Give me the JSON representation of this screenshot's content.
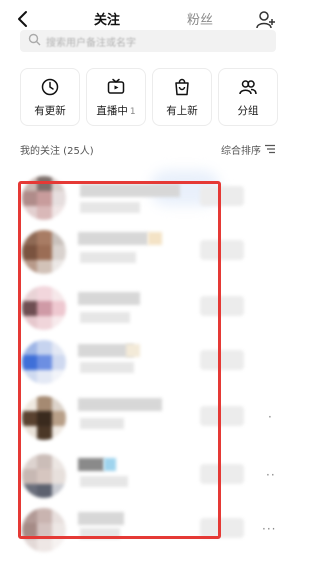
{
  "header": {
    "tabs": [
      {
        "label": "关注",
        "active": true
      },
      {
        "label": "粉丝",
        "active": false
      }
    ]
  },
  "search": {
    "placeholder": "搜索用户备注或名字"
  },
  "quick_actions": [
    {
      "label": "有更新",
      "icon": "clock-icon"
    },
    {
      "label": "直播中",
      "count": "1",
      "icon": "tv-icon"
    },
    {
      "label": "有上新",
      "icon": "shopping-bag-icon"
    },
    {
      "label": "分组",
      "icon": "group-icon"
    }
  ],
  "list": {
    "title": "我的关注 (25人)",
    "sort_label": "综合排序"
  },
  "colors": {
    "accent": "#111111",
    "highlight_box": "#e53935",
    "card_border": "#ececec"
  }
}
